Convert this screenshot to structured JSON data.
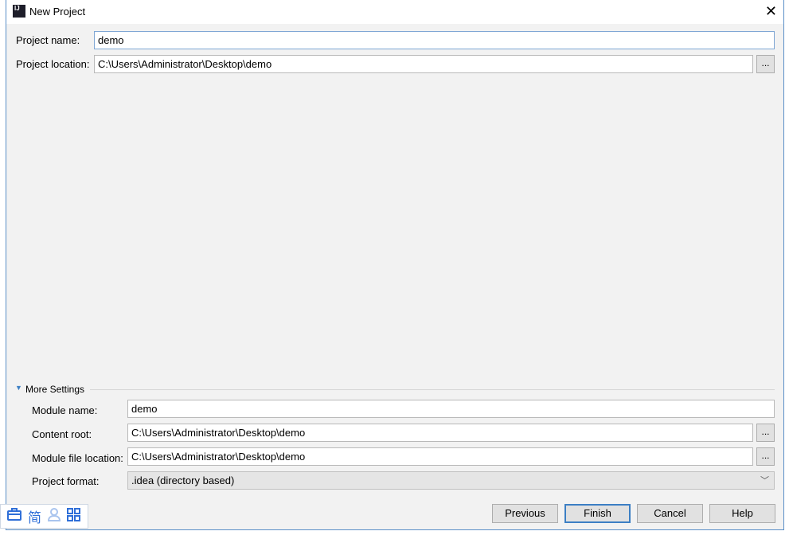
{
  "dialog": {
    "title": "New Project"
  },
  "fields": {
    "project_name": {
      "label": "Project name:",
      "value": "demo"
    },
    "project_location": {
      "label": "Project location:",
      "value": "C:\\Users\\Administrator\\Desktop\\demo",
      "browse": "..."
    }
  },
  "more_settings": {
    "label": "More Settings",
    "module_name": {
      "label": "Module name:",
      "value": "demo"
    },
    "content_root": {
      "label": "Content root:",
      "value": "C:\\Users\\Administrator\\Desktop\\demo",
      "browse": "..."
    },
    "module_file_location": {
      "label": "Module file location:",
      "value": "C:\\Users\\Administrator\\Desktop\\demo",
      "browse": "..."
    },
    "project_format": {
      "label": "Project format:",
      "value": ".idea (directory based)"
    }
  },
  "buttons": {
    "previous": "Previous",
    "finish": "Finish",
    "cancel": "Cancel",
    "help": "Help"
  },
  "toolbar": {
    "icons": [
      "briefcase-icon",
      "simplified-chinese-icon",
      "user-icon",
      "grid-icon"
    ],
    "simplified": "简"
  }
}
